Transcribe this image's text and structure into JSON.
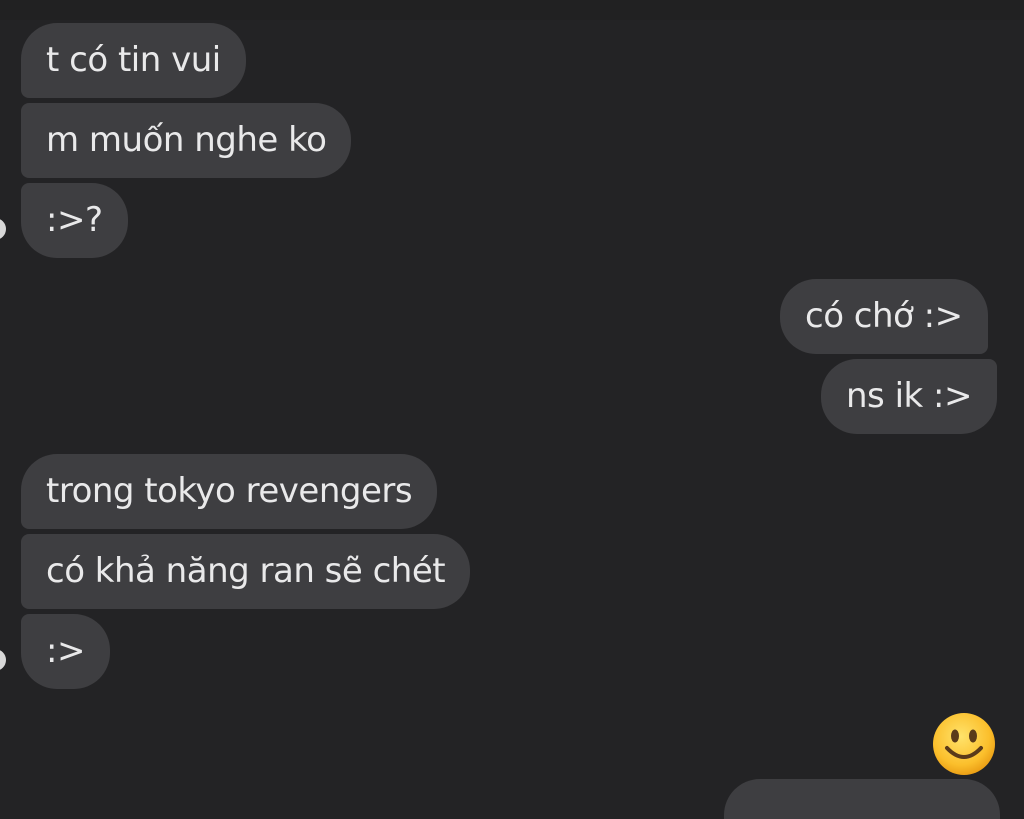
{
  "conversation": {
    "messages": [
      {
        "sender": "them",
        "text": "t có tin vui"
      },
      {
        "sender": "them",
        "text": "m muốn nghe ko"
      },
      {
        "sender": "them",
        "text": ":>?"
      },
      {
        "sender": "me",
        "text": "có chớ :>"
      },
      {
        "sender": "me",
        "text": "ns ik :>"
      },
      {
        "sender": "them",
        "text": "trong tokyo revengers"
      },
      {
        "sender": "them",
        "text": "có khả năng ran sẽ chét"
      },
      {
        "sender": "them",
        "text": ":>"
      }
    ],
    "reaction": {
      "icon": "smiling-face-emoji-icon"
    }
  },
  "theme": {
    "background": "#232325",
    "bubble": "#3e3e41",
    "text": "#e9e9ea"
  }
}
